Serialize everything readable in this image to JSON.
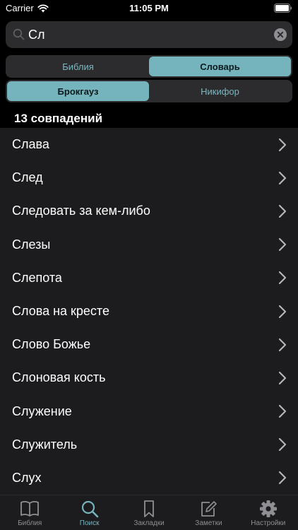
{
  "status_bar": {
    "carrier": "Carrier",
    "time": "11:05 PM"
  },
  "search": {
    "value": "Сл"
  },
  "source_tabs": [
    {
      "label": "Библия",
      "active": false
    },
    {
      "label": "Словарь",
      "active": true
    }
  ],
  "dictionary_tabs": [
    {
      "label": "Брокгауз",
      "active": true
    },
    {
      "label": "Никифор",
      "active": false
    }
  ],
  "results_count": "13 совпадений",
  "results": [
    "Слава",
    "След",
    "Следовать за кем-либо",
    "Слезы",
    "Слепота",
    "Слова на кресте",
    "Слово Божье",
    "Слоновая кость",
    "Служение",
    "Служитель",
    "Слух"
  ],
  "tab_bar": [
    {
      "label": "Библия",
      "icon": "book-icon",
      "active": false
    },
    {
      "label": "Поиск",
      "icon": "search-icon",
      "active": true
    },
    {
      "label": "Закладки",
      "icon": "bookmark-icon",
      "active": false
    },
    {
      "label": "Заметки",
      "icon": "note-edit-icon",
      "active": false
    },
    {
      "label": "Настройки",
      "icon": "gear-icon",
      "active": false
    }
  ],
  "colors": {
    "accent": "#76b4bd",
    "list_background": "#1c1c1e",
    "background": "#000000"
  }
}
